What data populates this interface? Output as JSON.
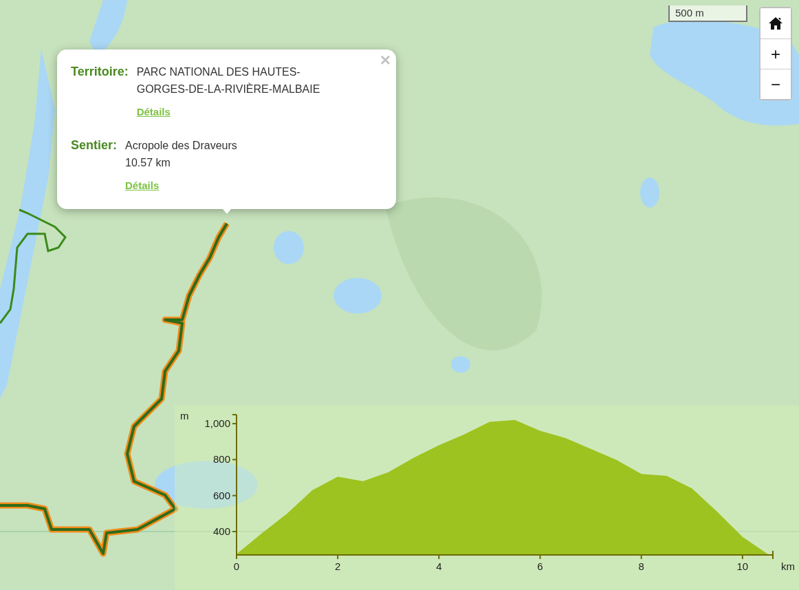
{
  "map": {
    "scale": "500 m",
    "controls": [
      {
        "kind": "home"
      },
      {
        "kind": "zoom_in",
        "label": "+"
      },
      {
        "kind": "zoom_out",
        "label": "−"
      }
    ]
  },
  "popup": {
    "close": "×",
    "sections": [
      {
        "label": "Territoire:",
        "lines": [
          "PARC NATIONAL DES HAUTES-GORGES-DE-LA-RIVIÈRE-MALBAIE"
        ],
        "link": "Détails"
      },
      {
        "label": "Sentier:",
        "lines": [
          "Acropole des Draveurs",
          "10.57 km"
        ],
        "link": "Détails"
      }
    ]
  },
  "elevation_profile": {
    "chart_data": {
      "type": "area",
      "xlabel": "km",
      "ylabel": "m",
      "x": [
        0,
        0.5,
        1,
        1.5,
        2,
        2.5,
        3,
        3.5,
        4,
        4.5,
        5,
        5.5,
        6,
        6.5,
        7,
        7.5,
        8,
        8.5,
        9,
        9.5,
        10,
        10.5
      ],
      "series": [
        {
          "color": "#9dc320",
          "values": [
            275,
            390,
            500,
            630,
            705,
            680,
            730,
            810,
            880,
            940,
            1010,
            1020,
            960,
            920,
            860,
            800,
            720,
            710,
            640,
            510,
            370,
            275
          ]
        }
      ],
      "xlim": [
        0,
        10.6
      ],
      "ylim": [
        270,
        1050
      ],
      "xticks": [
        0,
        2,
        4,
        6,
        8,
        10
      ],
      "yticks": [
        {
          "value": 400,
          "label": "400"
        },
        {
          "value": 600,
          "label": "600"
        },
        {
          "value": 800,
          "label": "800"
        },
        {
          "value": 1000,
          "label": "1,000"
        }
      ]
    }
  }
}
